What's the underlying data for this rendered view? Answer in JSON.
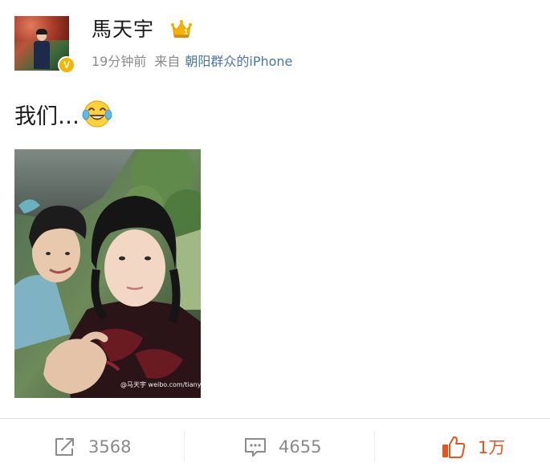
{
  "post": {
    "author": {
      "name": "馬天宇",
      "avatar_icon": "user-avatar-photo",
      "verified_icon": "verified-v-icon",
      "verified_letter": "V",
      "badge_icon": "crown-icon",
      "badge_color": "#f4b400"
    },
    "meta": {
      "time": "19分钟前",
      "from_label": "来自",
      "source": "朝阳群众的iPhone",
      "source_color": "#4a74ad"
    },
    "text": "我们…",
    "emoji": "laugh-cry-emoji",
    "image": {
      "description_icon": "photo-thumbnail",
      "watermark": "@马天宇 weibo.com/tianyuma"
    }
  },
  "actions": {
    "repost": {
      "icon": "repost-icon",
      "count": "3568"
    },
    "comment": {
      "icon": "comment-icon",
      "count": "4655"
    },
    "like": {
      "icon": "thumbs-up-icon",
      "count": "1万",
      "color": "#e8541c"
    }
  }
}
